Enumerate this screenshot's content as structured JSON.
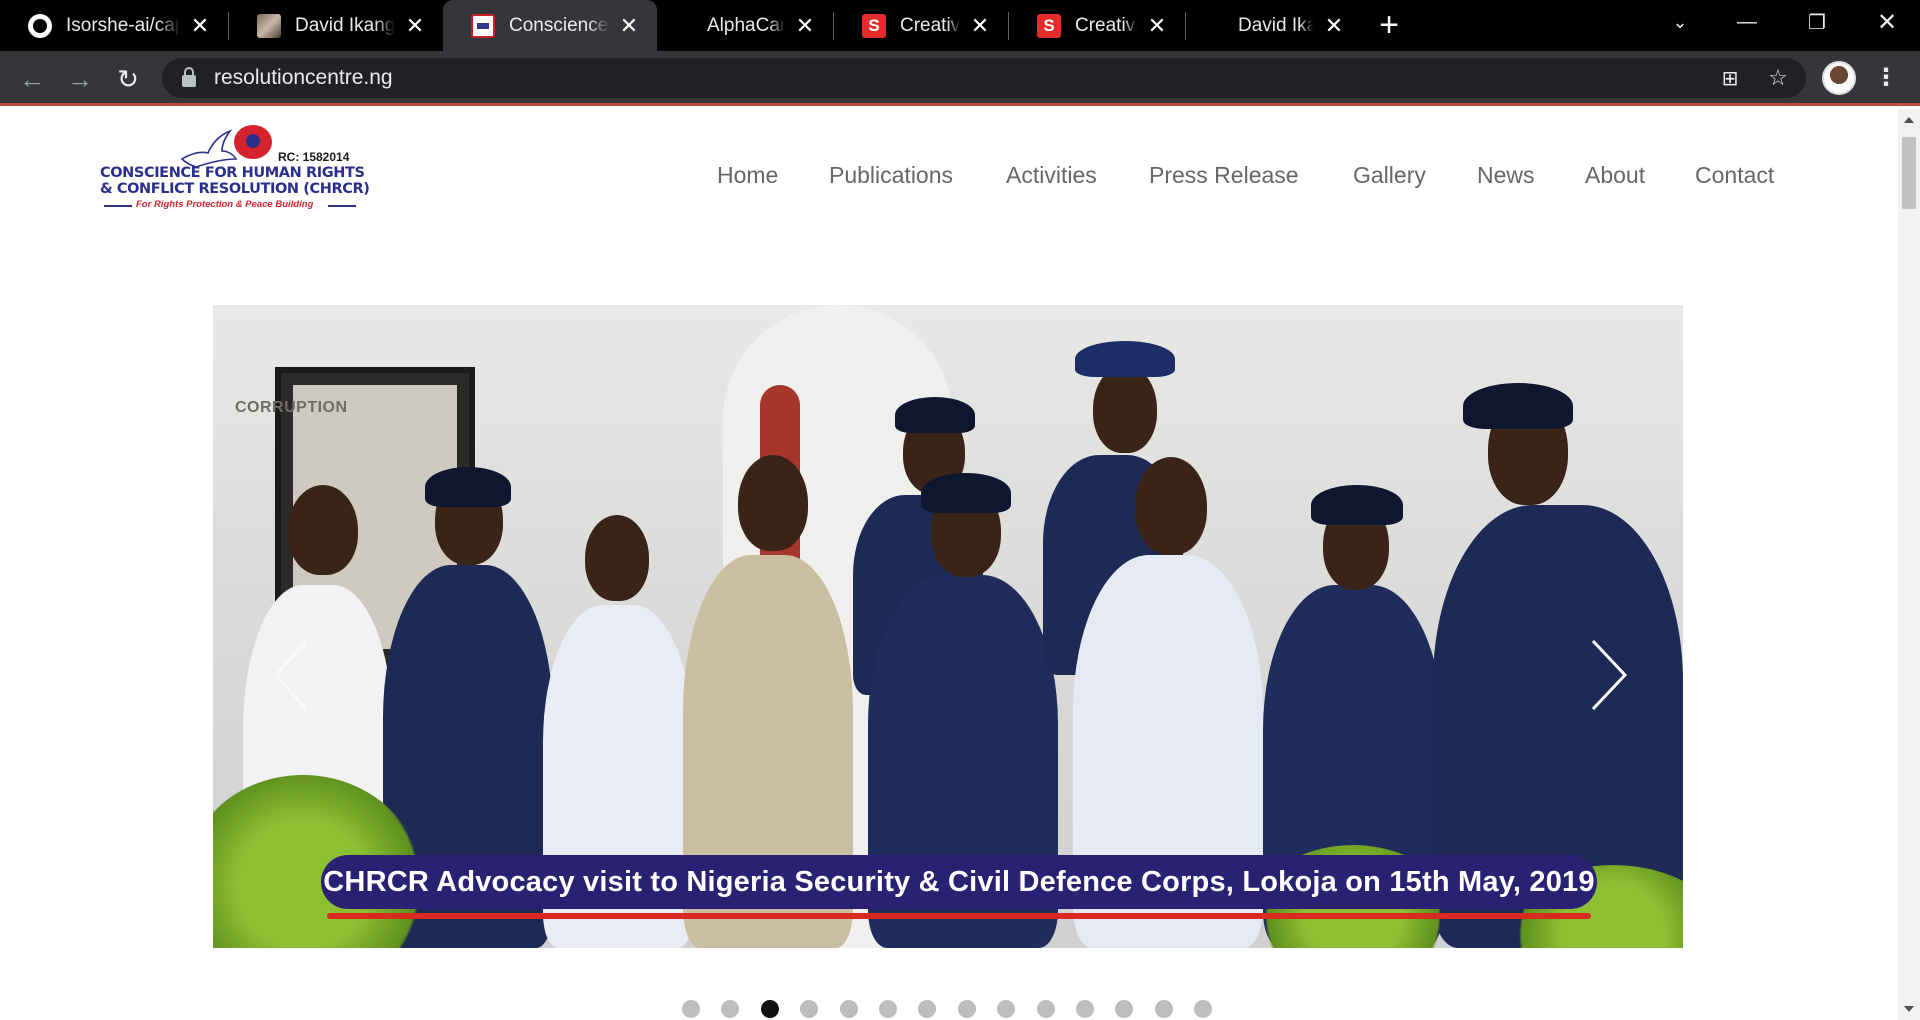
{
  "browser": {
    "tabs": [
      {
        "title": "Isorshe-ai/caps",
        "favicon": "github-icon",
        "active": false
      },
      {
        "title": "David Ikangbo",
        "favicon": "photo-icon",
        "active": false
      },
      {
        "title": "Conscience for",
        "favicon": "chrcr-icon",
        "active": true
      },
      {
        "title": "AlphaCare - La",
        "favicon": "none",
        "active": false
      },
      {
        "title": "Creative - One",
        "favicon": "s-icon",
        "active": false
      },
      {
        "title": "Creative - Ther",
        "favicon": "s-icon",
        "active": false
      },
      {
        "title": "David Ikangbo",
        "favicon": "none",
        "active": false
      }
    ],
    "url": "resolutioncentre.ng",
    "accent_color": "#c74a3d"
  },
  "site": {
    "logo": {
      "rc": "RC: 1582014",
      "line1": "CONSCIENCE FOR HUMAN RIGHTS",
      "line2": "& CONFLICT RESOLUTION (CHRCR)",
      "tagline": "For Rights Protection & Peace Building"
    },
    "nav": [
      "Home",
      "Publications",
      "Activities",
      "Press Release",
      "Gallery",
      "News",
      "About",
      "Contact"
    ]
  },
  "slider": {
    "board_text": "CORRUPTION",
    "caption": "CHRCR Advocacy visit to Nigeria Security & Civil Defence Corps, Lokoja on 15th May, 2019",
    "total_slides": 14,
    "active_slide": 3
  }
}
